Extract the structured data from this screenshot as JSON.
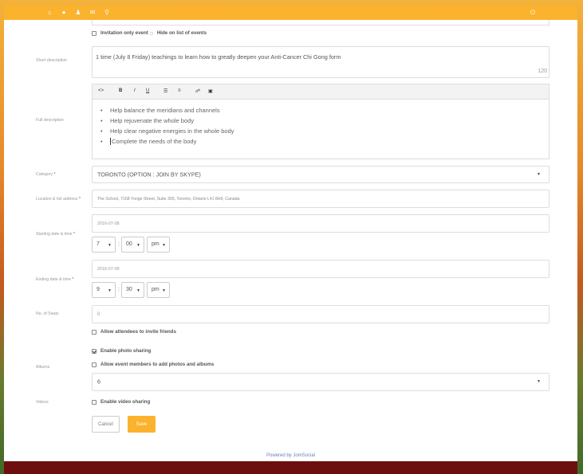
{
  "topbar": {
    "icons": [
      "home-icon",
      "globe-icon",
      "users-icon",
      "message-icon",
      "search-icon"
    ],
    "right_icon": "power-icon"
  },
  "invitation": {
    "invitation_only": "Invitation only event",
    "hide_on_list": "Hide on list of events"
  },
  "short_description": {
    "label": "Short description",
    "value": "1 time (July 8 Friday)  teachings to learn how to greatly deepen your Anti-Cancer Chi Gong form",
    "counter": "120"
  },
  "full_description": {
    "label": "Full description",
    "toolbar": [
      "<>",
      "B",
      "I",
      "U",
      "☰",
      "≡",
      "🔗",
      "▣"
    ],
    "items": [
      "Help balance the meridians and channels",
      "Help rejuvenate the whole body",
      "Help clear negative energies in the whole body",
      "Complete the needs of the body"
    ]
  },
  "category": {
    "label": "Category",
    "required": "*",
    "value": "TORONTO (OPTION : JOIN BY SKYPE)"
  },
  "location": {
    "label": "Location & full address",
    "required": "*",
    "value": "The School, 7168 Yonge Street, Suite 300, Toronto, Ontario L4J 8H9, Canada"
  },
  "start": {
    "label": "Starting date & time",
    "required": "*",
    "date": "2016-07-08",
    "hour": "7",
    "minute": "00",
    "ampm": "pm"
  },
  "end": {
    "label": "Ending date & time",
    "required": "*",
    "date": "2016-07-08",
    "hour": "9",
    "minute": "30",
    "ampm": "pm"
  },
  "seats": {
    "label": "No. of Seats",
    "value": "0"
  },
  "options": {
    "allow_invite": "Allow attendees to invite friends",
    "enable_photo": "Enable photo sharing",
    "allow_members_photos": "Allow event members to add photos and albums"
  },
  "albums": {
    "label": "Albums",
    "value": "6"
  },
  "videos": {
    "label": "Videos",
    "enable_video": "Enable video sharing"
  },
  "buttons": {
    "cancel": "Cancel",
    "save": "Save"
  },
  "footer": {
    "powered": "Powered by JomSocial"
  },
  "colors": {
    "accent": "#fbb22d",
    "footer": "#6d0f0f"
  }
}
